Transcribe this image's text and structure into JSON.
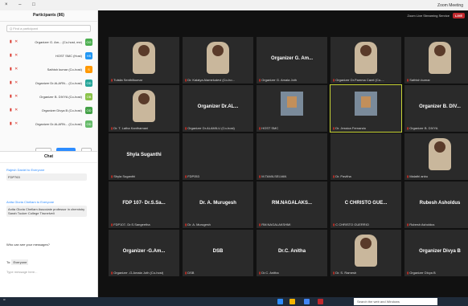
{
  "window": {
    "title": "Zoom Meeting",
    "controls": "× – □"
  },
  "sidebar": {
    "title": "Participants (86)",
    "search_placeholder": "Q Find a participant",
    "participants": [
      {
        "name": "Organizer G. Am... (Co-host, me)",
        "initials": "OG",
        "color": "#4caf50"
      },
      {
        "name": "HOST SMC (Host)",
        "initials": "HS",
        "color": "#2196f3"
      },
      {
        "name": "Sathish kumar (Co-host)",
        "initials": "S",
        "color": "#ff9800"
      },
      {
        "name": "Organizer Dr.ALARN... (Co-host)",
        "initials": "OD",
        "color": "#26a69a"
      },
      {
        "name": "Organizer B. DIVYA (Co-host)",
        "initials": "OB",
        "color": "#8bc34a"
      },
      {
        "name": "Organizer Divya B (Co-host)",
        "initials": "OD",
        "color": "#43a047"
      },
      {
        "name": "Organizer Dr.ALARN... (Co-host)",
        "initials": "OD",
        "color": "#66bb6a"
      }
    ],
    "invite_label": "Invite",
    "mute_all_label": "Mute All",
    "more_label": "..."
  },
  "chat": {
    "title": "Chat",
    "messages": [
      {
        "from": "Rajesh Daniel to Everyone",
        "text": "FDP763"
      },
      {
        "from": "Anita Gloria Chellam to Everyone",
        "text": "Anita Gloria Chellam Associate professor in chemistry Sarah Tucker College Tirunelveli"
      }
    ],
    "file_notice": "Who can see your messages?",
    "to_label": "To:",
    "to_value": "Everyone",
    "input_placeholder": "Type message here..."
  },
  "main": {
    "recording_text": "Zoom Live Streaming Service",
    "live_badge": "LIVE"
  },
  "tiles": [
    {
      "big": "",
      "label": "Tulsila Senthilkumar",
      "video": "person"
    },
    {
      "big": "",
      "label": "Dr. Kalaiya Alameludevi (Co-ho...",
      "video": "person"
    },
    {
      "big": "Organizer G. Am...",
      "label": "Organizer G. Amala Joth",
      "video": ""
    },
    {
      "big": "",
      "label": "Organizer Dr.Pamma Carel (Co-...",
      "video": "person"
    },
    {
      "big": "",
      "label": "Sathish kumar",
      "video": "person"
    },
    {
      "big": "",
      "label": "Dr. T. Latha Kanthamani",
      "video": "person"
    },
    {
      "big": "Organizer Dr.AL...",
      "label": "Organizer Dr.ALAMILU (Co-host)",
      "video": ""
    },
    {
      "big": "",
      "label": "HOST SMC",
      "video": "room"
    },
    {
      "big": "",
      "label": "Dr. Jessica Fernando",
      "video": "room"
    },
    {
      "big": "Organizer B. DIV...",
      "label": "Organizer B. DIVYA",
      "video": ""
    },
    {
      "big": "Shyla Suganthi",
      "label": "Shyla Suganthi",
      "video": ""
    },
    {
      "big": "",
      "label": "FDP053",
      "video": ""
    },
    {
      "big": "",
      "label": "M.TAMILSELVAN",
      "video": ""
    },
    {
      "big": "",
      "label": "Dr. Pavitha",
      "video": ""
    },
    {
      "big": "",
      "label": "Malathi anbu",
      "video": "person"
    },
    {
      "big": "FDP 107- Dr.S.Sa...",
      "label": "FDP107- Dr.S.Sangeetha",
      "video": ""
    },
    {
      "big": "Dr. A. Murugesh",
      "label": "Dr. A. Murugesh",
      "video": ""
    },
    {
      "big": "RM.NAGALAKS...",
      "label": "RM.NAGALAKSHMI",
      "video": ""
    },
    {
      "big": "C CHRISTO GUE...",
      "label": "C CHRISTO GUERRIO",
      "video": ""
    },
    {
      "big": "Rubesh Asholdus",
      "label": "Rubesh Asholdus",
      "video": ""
    },
    {
      "big": "Organizer -G.Am...",
      "label": "Organizer -G.Amala Joth (Co-host)",
      "video": ""
    },
    {
      "big": "DSB",
      "label": "DSB",
      "video": ""
    },
    {
      "big": "Dr.C. Anitha",
      "label": "Dr.C. Anitha",
      "video": ""
    },
    {
      "big": "",
      "label": "Dr. S. Ramesh",
      "video": "person"
    },
    {
      "big": "Organizer Divya B",
      "label": "Organizer Divya B",
      "video": ""
    }
  ],
  "taskbar": {
    "search_placeholder": "Search the web and Windows"
  }
}
